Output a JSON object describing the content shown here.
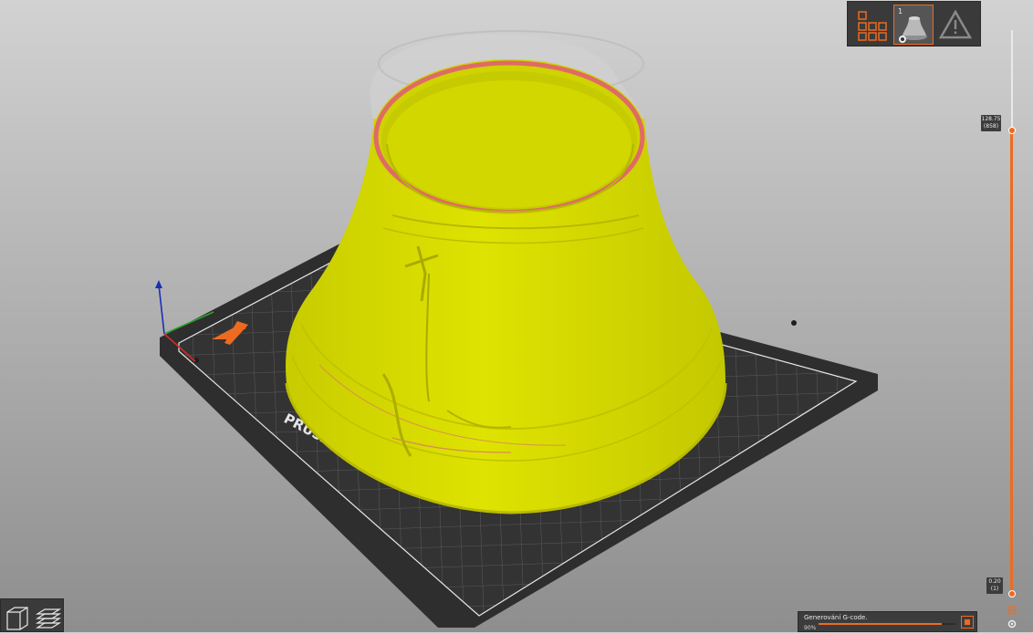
{
  "app": {
    "accent": "#ed6b21",
    "model_color": "#d9dd00"
  },
  "bed": {
    "logo_text": "PRUSA"
  },
  "object_list": {
    "items": [
      {
        "icon": "arrange-grid-icon",
        "selected": false
      },
      {
        "number": "1",
        "icon": "bell-thumbnail-icon",
        "selected": true
      },
      {
        "icon": "warning-icon",
        "selected": false
      }
    ]
  },
  "layer_slider": {
    "top": {
      "height": "128.75",
      "layer": "(858)"
    },
    "bottom": {
      "height": "0.20",
      "layer": "(1)"
    }
  },
  "view_toggle": {
    "items": [
      {
        "icon": "3d-view-icon"
      },
      {
        "icon": "preview-layers-icon"
      }
    ]
  },
  "progress": {
    "status": "Generování G-code.",
    "percent_label": "90%",
    "percent": 90
  }
}
